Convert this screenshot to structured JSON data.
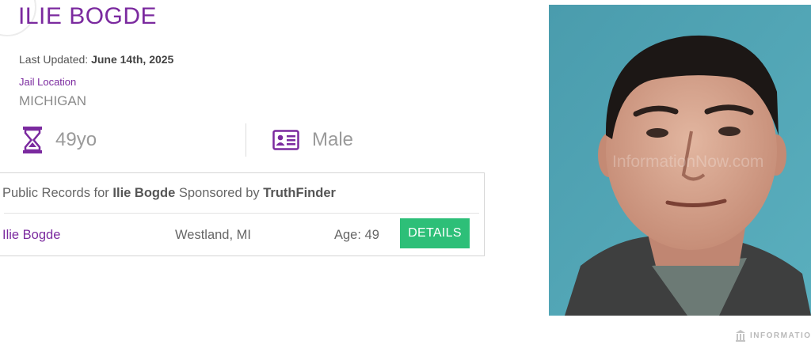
{
  "profile": {
    "name": "ILIE BOGDE",
    "last_updated_label": "Last Updated:",
    "last_updated_value": "June 14th, 2025",
    "jail_location_label": "Jail Location",
    "jail_location_value": "MICHIGAN",
    "age": "49yo",
    "sex": "Male"
  },
  "records": {
    "prefix": "Public Records for",
    "person": "Ilie Bogde",
    "middle": "Sponsored by",
    "sponsor": "TruthFinder",
    "row": {
      "name": "Ilie Bogde",
      "location": "Westland, MI",
      "age": "Age: 49",
      "button_label": "DETAILS"
    }
  },
  "photo": {
    "watermark_text": "InformationNow.com"
  },
  "footer": {
    "logo_text": "INFORMATIO"
  },
  "colors": {
    "accent_purple": "#7b2a9f",
    "button_green": "#2dbf78",
    "photo_background": "#4fa3b3"
  },
  "icons": {
    "age": "hourglass-icon",
    "sex": "id-card-icon",
    "logo": "building-icon"
  }
}
